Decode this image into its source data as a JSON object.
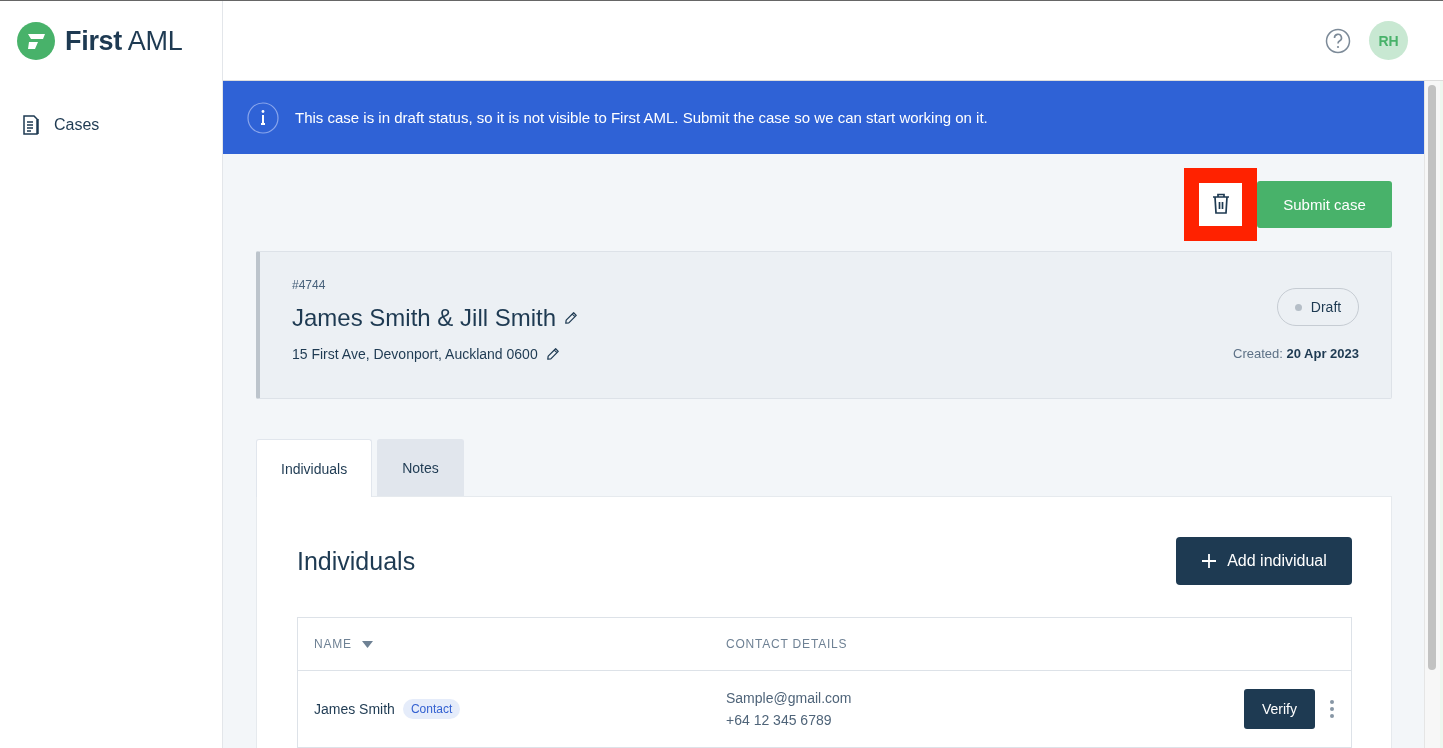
{
  "sidebar": {
    "logo": "**First** AML",
    "items": [
      {
        "label": "Cases"
      }
    ]
  },
  "header": {
    "avatar": "RH"
  },
  "banner": {
    "message": "This case is in draft status, so it is not visible to First AML. Submit the case so we can start working on it."
  },
  "actions": {
    "submit": "Submit case"
  },
  "case": {
    "number": "#4744",
    "title": "James Smith & Jill Smith",
    "address": "15 First Ave, Devonport, Auckland 0600",
    "status": "Draft",
    "created": "Created: **20 Apr 2023**"
  },
  "tabs": [
    {
      "label": "Individuals",
      "selected": true
    },
    {
      "label": "Notes",
      "selected": false
    }
  ],
  "individuals": {
    "heading": "Individuals",
    "add_button": "Add individual",
    "columns": [
      "NAME",
      "CONTACT DETAILS"
    ],
    "rows": [
      {
        "name": "James Smith",
        "tag": "Contact",
        "email": "Sample@gmail.com",
        "phone": "+64 12 345 6789",
        "action": "Verify"
      }
    ]
  }
}
